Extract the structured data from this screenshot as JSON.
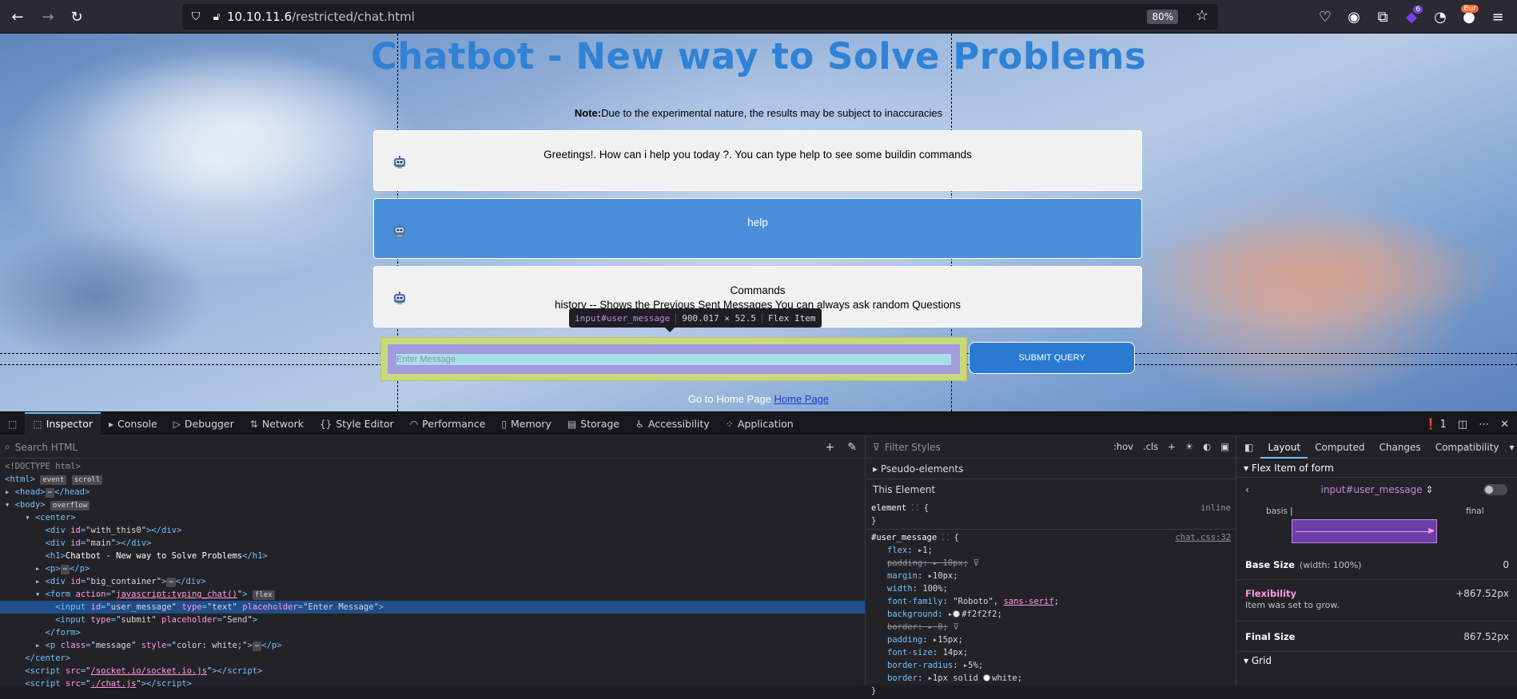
{
  "browser": {
    "url_host": "10.10.11.6",
    "url_path": "/restricted/chat.html",
    "zoom": "80%",
    "extension_badge": "6",
    "burp_label": "Bur"
  },
  "page": {
    "title": "Chatbot - New way to Solve Problems",
    "note_bold": "Note:",
    "note_text": "Due to the experimental nature, the results may be subject to inaccuracies",
    "messages": [
      {
        "type": "bot",
        "text": "Greetings!. How can i help you today ?. You can type help to see some buildin commands"
      },
      {
        "type": "user",
        "text": "help"
      },
      {
        "type": "bot",
        "line1": "Commands",
        "line2": "history -- Shows the Previous Sent Messages You can always ask random Questions"
      }
    ],
    "input_placeholder": "Enter Message",
    "submit_label": "SUBMIT QUERY",
    "footer_text": "Go to Home Page ",
    "footer_link": "Home Page",
    "highlight_tooltip": {
      "selector": "input#user_message",
      "size": "900.017 × 52.5",
      "kind": "Flex Item"
    }
  },
  "devtools": {
    "tabs": [
      "Inspector",
      "Console",
      "Debugger",
      "Network",
      "Style Editor",
      "Performance",
      "Memory",
      "Storage",
      "Accessibility",
      "Application"
    ],
    "active_tab": "Inspector",
    "error_count": "1",
    "search_placeholder": "Search HTML",
    "filter_placeholder": "Filter Styles",
    "hov": ":hov",
    "cls": ".cls",
    "pseudo_elements": "Pseudo-elements",
    "this_element": "This Element",
    "element_rule": "element",
    "inline": "inline",
    "rule_selector": "#user_message",
    "rule_source": "chat.css:32",
    "layout_tabs": [
      "Layout",
      "Computed",
      "Changes",
      "Compatibility"
    ],
    "flex_item_heading": "Flex Item of form",
    "flex_item_selector": "input#user_message",
    "basis_label": "basis",
    "final_label": "final",
    "base_size_label": "Base Size",
    "base_size_sub": "(width: 100%)",
    "base_size_value": "0",
    "flexibility_label": "Flexibility",
    "flexibility_value": "+867.52px",
    "flexibility_desc": "Item was set to grow.",
    "final_size_label": "Final Size",
    "final_size_value": "867.52px",
    "grid_label": "Grid"
  }
}
